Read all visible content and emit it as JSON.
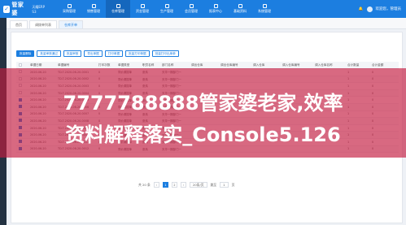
{
  "app": {
    "logo_text": "管家婆",
    "logo_sub": "天耀ERP S3",
    "nav": [
      {
        "label": "采购管理",
        "active": false
      },
      {
        "label": "销售管理",
        "active": false
      },
      {
        "label": "仓库管理",
        "active": true
      },
      {
        "label": "资金管理",
        "active": false
      },
      {
        "label": "生产管理",
        "active": false
      },
      {
        "label": "会员管理",
        "active": false
      },
      {
        "label": "报表中心",
        "active": false
      },
      {
        "label": "基础资料",
        "active": false
      },
      {
        "label": "系统管理",
        "active": false
      }
    ],
    "user": "欢迎您，管理员"
  },
  "tabs": [
    {
      "label": "首页",
      "active": false
    },
    {
      "label": "调拨单列表",
      "active": false
    },
    {
      "label": "仓库开单",
      "active": true
    }
  ],
  "toolbar": [
    {
      "label": "批量删除",
      "primary": true
    },
    {
      "label": "批量审核通过",
      "primary": false
    },
    {
      "label": "批量审核",
      "primary": false
    },
    {
      "label": "导出单据",
      "primary": false
    },
    {
      "label": "打印单据",
      "primary": false
    },
    {
      "label": "批量打印单据",
      "primary": false
    },
    {
      "label": "批量打印出库单",
      "primary": false
    }
  ],
  "table": {
    "columns": [
      "",
      "单据日期",
      "单据编号",
      "打印次数",
      "单据类型",
      "职员名称",
      "部门名称",
      "调出仓库",
      "调出仓库编号",
      "调入仓库",
      "调入仓库编号",
      "调入仓库名称",
      "合计数量",
      "合计金额"
    ],
    "rows": [
      {
        "checked": false,
        "date": "2020-06-20",
        "no": "TD-T-2020-06-20-0001",
        "prints": "0",
        "type": "同价调拨单",
        "staff": "张炜",
        "dept": "天华一期部门一",
        "qty": "1",
        "amt": "0"
      },
      {
        "checked": false,
        "date": "2020-06-20",
        "no": "TD-T-2020-06-20-0002",
        "prints": "0",
        "type": "同价调拨单",
        "staff": "张炜",
        "dept": "天华一期部门一",
        "qty": "1",
        "amt": "0"
      },
      {
        "checked": false,
        "date": "2020-06-20",
        "no": "TD-T-2020-06-20-0003",
        "prints": "0",
        "type": "同价调拨单",
        "staff": "张炜",
        "dept": "天华一期部门一",
        "qty": "1",
        "amt": "0"
      },
      {
        "checked": false,
        "date": "2020-06-20",
        "no": "TD-T-2020-06-20-0004",
        "prints": "0",
        "type": "同价调拨单",
        "staff": "张炜",
        "dept": "天华一期部门一",
        "qty": "1",
        "amt": "0"
      },
      {
        "checked": true,
        "date": "2020-06-20",
        "no": "TD-T-2020-06-20-0005",
        "prints": "0",
        "type": "同价调拨单",
        "staff": "张炜",
        "dept": "天华一期部门一",
        "qty": "1",
        "amt": "0"
      },
      {
        "checked": true,
        "date": "2020-06-20",
        "no": "TD-T-2020-06-20-0006",
        "prints": "0",
        "type": "同价调拨单",
        "staff": "张炜",
        "dept": "天华一期部门一",
        "qty": "1",
        "amt": "0"
      },
      {
        "checked": true,
        "date": "2020-06-20",
        "no": "TD-T-2020-06-20-0007",
        "prints": "0",
        "type": "同价调拨单",
        "staff": "张炜",
        "dept": "天华一期部门一",
        "qty": "1",
        "amt": "0"
      },
      {
        "checked": true,
        "date": "2020-06-20",
        "no": "TD-T-2020-06-20-0008",
        "prints": "0",
        "type": "同价调拨单",
        "staff": "张炜",
        "dept": "天华一期部门一",
        "qty": "1",
        "amt": "0"
      },
      {
        "checked": true,
        "date": "2020-06-20",
        "no": "TD-T-2020-06-20-0009",
        "prints": "0",
        "type": "同价调拨单",
        "staff": "张炜",
        "dept": "天华一期部门一",
        "qty": "1",
        "amt": "0"
      },
      {
        "checked": true,
        "date": "2020-06-20",
        "no": "TD-T-2020-06-20-0010",
        "prints": "0",
        "type": "同价调拨单",
        "staff": "张炜",
        "dept": "天华一期部门一",
        "qty": "1",
        "amt": "0"
      },
      {
        "checked": true,
        "date": "2020-06-20",
        "no": "TD-T-2020-06-20-0011",
        "prints": "0",
        "type": "同价调拨单",
        "staff": "张炜",
        "dept": "天华一期部门一",
        "qty": "1",
        "amt": "0"
      },
      {
        "checked": true,
        "date": "2020-06-20",
        "no": "TD-T-2020-06-20-0012",
        "prints": "0",
        "type": "同价调拨单",
        "staff": "张炜",
        "dept": "天华一期部门一",
        "qty": "1",
        "amt": "0"
      }
    ]
  },
  "pager": {
    "total": "共 20 条",
    "pages": [
      "1",
      "2"
    ],
    "current": "1",
    "page_size": "20条/页",
    "goto_label": "跳至",
    "goto_value": "1",
    "page_suffix": "页"
  },
  "overlay": {
    "line1": "7777788888管家婆老家,效率",
    "line2": "资料解释落实_Console5.126"
  }
}
